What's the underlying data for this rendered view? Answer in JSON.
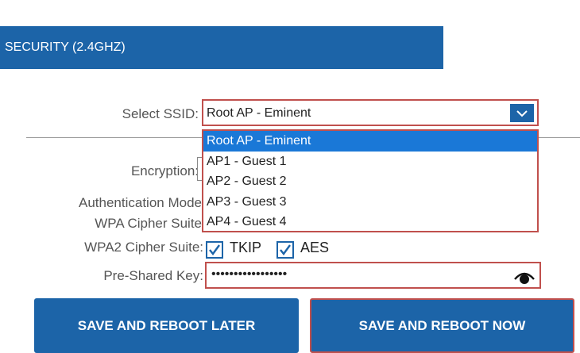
{
  "section": {
    "title": "SECURITY (2.4GHZ)"
  },
  "form": {
    "ssid_label": "Select SSID:",
    "ssid_value": "Root AP - Eminent",
    "encryption_label": "Encryption:",
    "auth_label": "Authentication Mode",
    "wpa_cipher_label": "WPA Cipher Suite",
    "wpa2_cipher_label": "WPA2 Cipher Suite:",
    "tkip_label": "TKIP",
    "aes_label": "AES",
    "psk_label": "Pre-Shared Key:",
    "psk_value": "•••••••••••••••••",
    "tkip_checked": true,
    "aes_checked": true
  },
  "dropdown": {
    "options": [
      "Root AP - Eminent",
      "AP1 - Guest 1",
      "AP2 - Guest 2",
      "AP3 - Guest 3",
      "AP4 - Guest 4"
    ],
    "selected_index": 0
  },
  "buttons": {
    "save_later": "SAVE AND REBOOT LATER",
    "save_now": "SAVE AND REBOOT NOW"
  },
  "colors": {
    "accent": "#1c64a8",
    "highlight": "#1a78d7",
    "error_border": "#c0504d"
  },
  "icons": {
    "dropdown_arrow": "chevron-down-icon",
    "show_password": "eye-icon",
    "checkbox": "check-icon"
  }
}
